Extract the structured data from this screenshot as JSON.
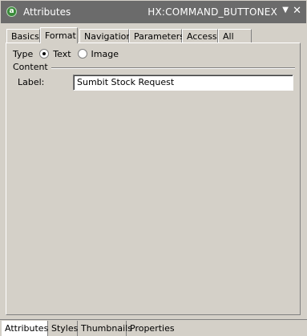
{
  "window": {
    "title": "Attributes",
    "component_id": "HX:COMMAND_BUTTONEX",
    "menu_glyph": "▼",
    "close_glyph": "✕",
    "icon_glyph": "a"
  },
  "tabs": [
    {
      "label": "Basics",
      "active": false
    },
    {
      "label": "Format",
      "active": true
    },
    {
      "label": "Navigation",
      "active": false
    },
    {
      "label": "Parameters",
      "active": false
    },
    {
      "label": "Access",
      "active": false
    },
    {
      "label": "All",
      "active": false
    }
  ],
  "format": {
    "type_label": "Type",
    "type_options": [
      {
        "label": "Text",
        "checked": true
      },
      {
        "label": "Image",
        "checked": false
      }
    ],
    "content_section": "Content",
    "label_caption": "Label:",
    "label_value": "Sumbit Stock Request"
  },
  "bottom_tabs": [
    {
      "label": "Attributes",
      "active": true
    },
    {
      "label": "Styles",
      "active": false
    },
    {
      "label": "Thumbnails",
      "active": false
    },
    {
      "label": "Properties",
      "active": false
    }
  ]
}
